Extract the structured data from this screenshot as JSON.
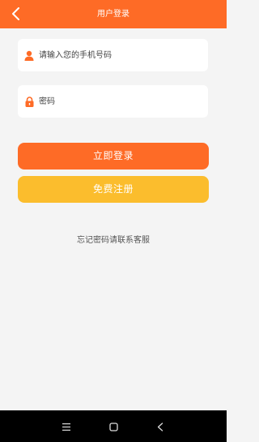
{
  "header": {
    "title": "用户登录",
    "back_icon": "chevron-left-icon",
    "background": "#fe6b26"
  },
  "form": {
    "phone": {
      "placeholder": "请输入您的手机号码",
      "icon": "user-icon",
      "value": ""
    },
    "password": {
      "placeholder": "密码",
      "icon": "lock-icon",
      "value": ""
    }
  },
  "buttons": {
    "login_label": "立即登录",
    "login_color": "#fe6b26",
    "register_label": "免费注册",
    "register_color": "#fbbd2d"
  },
  "footer_note": "忘记密码请联系客服",
  "system_nav": {
    "menu_icon": "menu-icon",
    "home_icon": "square-home-icon",
    "back_icon": "triangle-back-icon"
  }
}
